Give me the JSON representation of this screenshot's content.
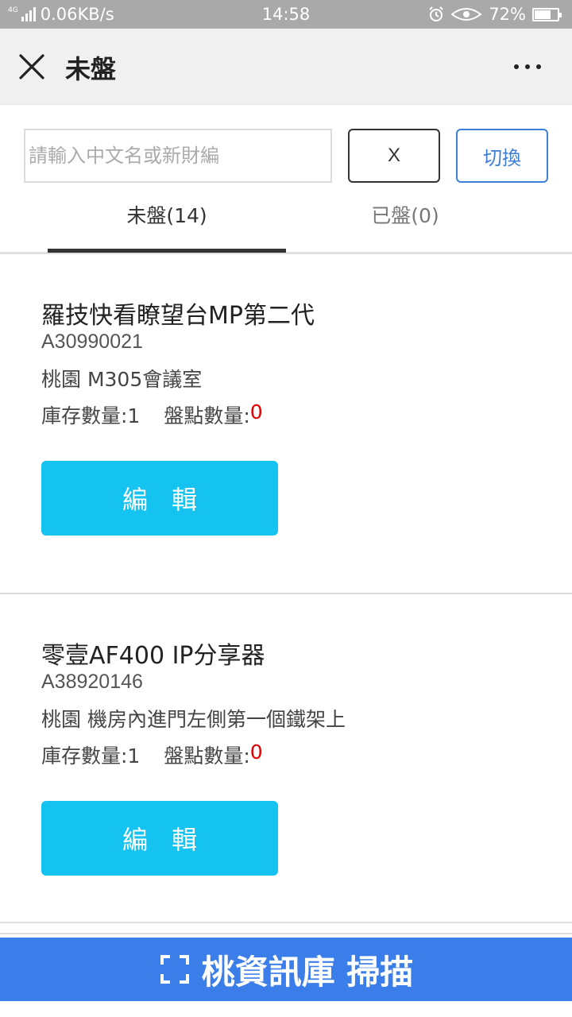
{
  "status_bar": {
    "network_type": "4G",
    "speed": "0.06KB/s",
    "time": "14:58",
    "battery_percent": "72%",
    "battery_level": 0.72,
    "icons": [
      "signal-icon",
      "alarm-icon",
      "eye-icon",
      "battery-icon"
    ]
  },
  "nav": {
    "title": "未盤",
    "close_icon": "close-icon",
    "more_icon": "more-icon"
  },
  "search": {
    "placeholder": "請輸入中文名或新財編",
    "value": "",
    "clear_label": "X",
    "switch_label": "切換"
  },
  "tabs": [
    {
      "label": "未盤(14)",
      "active": true
    },
    {
      "label": "已盤(0)",
      "active": false
    }
  ],
  "items": [
    {
      "name": "羅技快看瞭望台MP第二代",
      "code": "A30990021",
      "location": "桃園 M305會議室",
      "stock_label": "庫存數量:1",
      "count_label": "盤點數量:",
      "count_value": "0",
      "edit_label": "編輯"
    },
    {
      "name": "零壹AF400 IP分享器",
      "code": "A38920146",
      "location": "桃園 機房內進門左側第一個鐵架上",
      "stock_label": "庫存數量:1",
      "count_label": "盤點數量:",
      "count_value": "0",
      "edit_label": "編輯"
    }
  ],
  "scan_bar": {
    "label": "桃資訊庫 掃描",
    "icon": "scan-icon"
  },
  "colors": {
    "accent_blue": "#3b7ee9",
    "edit_button": "#14c3ef",
    "count_red": "#e10000",
    "switch_border": "#3d7fd6"
  }
}
